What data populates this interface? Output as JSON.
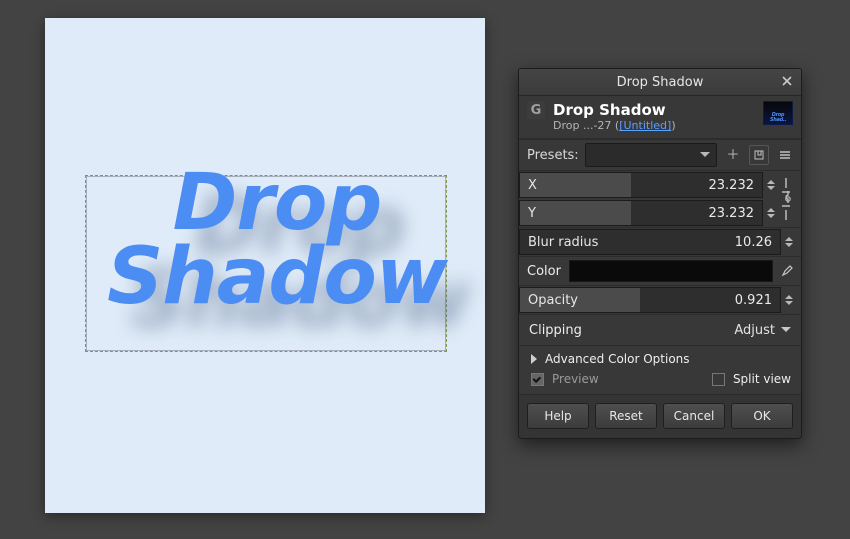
{
  "canvas": {
    "text_line1": "Drop",
    "text_line2": "Shadow"
  },
  "dialog": {
    "window_title": "Drop Shadow",
    "main_title": "Drop Shadow",
    "sub_prefix": "Drop ...-27 (",
    "sub_link": "[Untitled]",
    "sub_suffix": ")",
    "presets_label": "Presets:",
    "params": {
      "x": {
        "label": "X",
        "value": "23.232",
        "fill_pct": 46
      },
      "y": {
        "label": "Y",
        "value": "23.232",
        "fill_pct": 46
      },
      "blur": {
        "label": "Blur radius",
        "value": "10.26",
        "fill_pct": 0
      },
      "opacity": {
        "label": "Opacity",
        "value": "0.921",
        "fill_pct": 46
      }
    },
    "color_label": "Color",
    "color_value": "#000000",
    "clipping": {
      "label": "Clipping",
      "value": "Adjust"
    },
    "advanced_label": "Advanced Color Options",
    "preview_label": "Preview",
    "splitview_label": "Split view",
    "buttons": {
      "help": "Help",
      "reset": "Reset",
      "cancel": "Cancel",
      "ok": "OK"
    }
  }
}
